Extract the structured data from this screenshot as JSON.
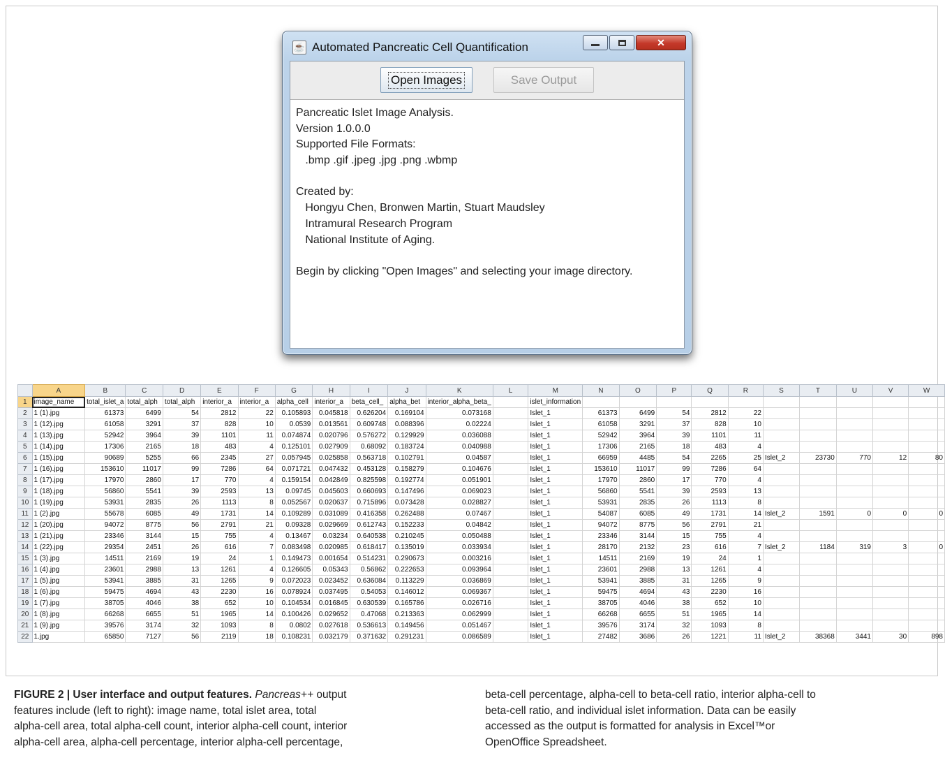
{
  "dialog": {
    "title": "Automated Pancreatic Cell Quantification",
    "buttons": {
      "open": "Open Images",
      "save": "Save Output"
    },
    "text_lines": [
      "Pancreatic Islet Image Analysis.",
      "Version 1.0.0.0",
      "Supported File Formats:",
      "   .bmp .gif .jpeg .jpg .png .wbmp",
      "",
      "Created by:",
      "   Hongyu Chen, Bronwen Martin, Stuart Maudsley",
      "   Intramural Research Program",
      "   National Institute of Aging.",
      "",
      "Begin by clicking \"Open Images\" and selecting your image directory."
    ]
  },
  "spreadsheet": {
    "column_letters": [
      "A",
      "B",
      "C",
      "D",
      "E",
      "F",
      "G",
      "H",
      "I",
      "J",
      "K",
      "L",
      "M",
      "N",
      "O",
      "P",
      "Q",
      "R",
      "S",
      "T",
      "U",
      "V",
      "W"
    ],
    "header_row": [
      "image_name",
      "total_islet_a",
      "total_alph",
      "total_alph",
      "interior_a",
      "interior_a",
      "alpha_cell",
      "interior_a",
      "beta_cell_",
      "alpha_bet",
      "interior_alpha_beta_",
      "",
      "islet_information",
      "",
      "",
      "",
      "",
      "",
      "",
      "",
      "",
      "",
      ""
    ],
    "rows": [
      [
        "1 (1).jpg",
        "61373",
        "6499",
        "54",
        "2812",
        "22",
        "0.105893",
        "0.045818",
        "0.626204",
        "0.169104",
        "0.073168",
        "",
        "Islet_1",
        "61373",
        "6499",
        "54",
        "2812",
        "22",
        "",
        "",
        "",
        "",
        ""
      ],
      [
        "1 (12).jpg",
        "61058",
        "3291",
        "37",
        "828",
        "10",
        "0.0539",
        "0.013561",
        "0.609748",
        "0.088396",
        "0.02224",
        "",
        "Islet_1",
        "61058",
        "3291",
        "37",
        "828",
        "10",
        "",
        "",
        "",
        "",
        ""
      ],
      [
        "1 (13).jpg",
        "52942",
        "3964",
        "39",
        "1101",
        "11",
        "0.074874",
        "0.020796",
        "0.576272",
        "0.129929",
        "0.036088",
        "",
        "Islet_1",
        "52942",
        "3964",
        "39",
        "1101",
        "11",
        "",
        "",
        "",
        "",
        ""
      ],
      [
        "1 (14).jpg",
        "17306",
        "2165",
        "18",
        "483",
        "4",
        "0.125101",
        "0.027909",
        "0.68092",
        "0.183724",
        "0.040988",
        "",
        "Islet_1",
        "17306",
        "2165",
        "18",
        "483",
        "4",
        "",
        "",
        "",
        "",
        ""
      ],
      [
        "1 (15).jpg",
        "90689",
        "5255",
        "66",
        "2345",
        "27",
        "0.057945",
        "0.025858",
        "0.563718",
        "0.102791",
        "0.04587",
        "",
        "Islet_1",
        "66959",
        "4485",
        "54",
        "2265",
        "25",
        "Islet_2",
        "23730",
        "770",
        "12",
        "80"
      ],
      [
        "1 (16).jpg",
        "153610",
        "11017",
        "99",
        "7286",
        "64",
        "0.071721",
        "0.047432",
        "0.453128",
        "0.158279",
        "0.104676",
        "",
        "Islet_1",
        "153610",
        "11017",
        "99",
        "7286",
        "64",
        "",
        "",
        "",
        "",
        ""
      ],
      [
        "1 (17).jpg",
        "17970",
        "2860",
        "17",
        "770",
        "4",
        "0.159154",
        "0.042849",
        "0.825598",
        "0.192774",
        "0.051901",
        "",
        "Islet_1",
        "17970",
        "2860",
        "17",
        "770",
        "4",
        "",
        "",
        "",
        "",
        ""
      ],
      [
        "1 (18).jpg",
        "56860",
        "5541",
        "39",
        "2593",
        "13",
        "0.09745",
        "0.045603",
        "0.660693",
        "0.147496",
        "0.069023",
        "",
        "Islet_1",
        "56860",
        "5541",
        "39",
        "2593",
        "13",
        "",
        "",
        "",
        "",
        ""
      ],
      [
        "1 (19).jpg",
        "53931",
        "2835",
        "26",
        "1113",
        "8",
        "0.052567",
        "0.020637",
        "0.715896",
        "0.073428",
        "0.028827",
        "",
        "Islet_1",
        "53931",
        "2835",
        "26",
        "1113",
        "8",
        "",
        "",
        "",
        "",
        ""
      ],
      [
        "1 (2).jpg",
        "55678",
        "6085",
        "49",
        "1731",
        "14",
        "0.109289",
        "0.031089",
        "0.416358",
        "0.262488",
        "0.07467",
        "",
        "Islet_1",
        "54087",
        "6085",
        "49",
        "1731",
        "14",
        "Islet_2",
        "1591",
        "0",
        "0",
        "0"
      ],
      [
        "1 (20).jpg",
        "94072",
        "8775",
        "56",
        "2791",
        "21",
        "0.09328",
        "0.029669",
        "0.612743",
        "0.152233",
        "0.04842",
        "",
        "Islet_1",
        "94072",
        "8775",
        "56",
        "2791",
        "21",
        "",
        "",
        "",
        "",
        ""
      ],
      [
        "1 (21).jpg",
        "23346",
        "3144",
        "15",
        "755",
        "4",
        "0.13467",
        "0.03234",
        "0.640538",
        "0.210245",
        "0.050488",
        "",
        "Islet_1",
        "23346",
        "3144",
        "15",
        "755",
        "4",
        "",
        "",
        "",
        "",
        ""
      ],
      [
        "1 (22).jpg",
        "29354",
        "2451",
        "26",
        "616",
        "7",
        "0.083498",
        "0.020985",
        "0.618417",
        "0.135019",
        "0.033934",
        "",
        "Islet_1",
        "28170",
        "2132",
        "23",
        "616",
        "7",
        "Islet_2",
        "1184",
        "319",
        "3",
        "0"
      ],
      [
        "1 (3).jpg",
        "14511",
        "2169",
        "19",
        "24",
        "1",
        "0.149473",
        "0.001654",
        "0.514231",
        "0.290673",
        "0.003216",
        "",
        "Islet_1",
        "14511",
        "2169",
        "19",
        "24",
        "1",
        "",
        "",
        "",
        "",
        ""
      ],
      [
        "1 (4).jpg",
        "23601",
        "2988",
        "13",
        "1261",
        "4",
        "0.126605",
        "0.05343",
        "0.56862",
        "0.222653",
        "0.093964",
        "",
        "Islet_1",
        "23601",
        "2988",
        "13",
        "1261",
        "4",
        "",
        "",
        "",
        "",
        ""
      ],
      [
        "1 (5).jpg",
        "53941",
        "3885",
        "31",
        "1265",
        "9",
        "0.072023",
        "0.023452",
        "0.636084",
        "0.113229",
        "0.036869",
        "",
        "Islet_1",
        "53941",
        "3885",
        "31",
        "1265",
        "9",
        "",
        "",
        "",
        "",
        ""
      ],
      [
        "1 (6).jpg",
        "59475",
        "4694",
        "43",
        "2230",
        "16",
        "0.078924",
        "0.037495",
        "0.54053",
        "0.146012",
        "0.069367",
        "",
        "Islet_1",
        "59475",
        "4694",
        "43",
        "2230",
        "16",
        "",
        "",
        "",
        "",
        ""
      ],
      [
        "1 (7).jpg",
        "38705",
        "4046",
        "38",
        "652",
        "10",
        "0.104534",
        "0.016845",
        "0.630539",
        "0.165786",
        "0.026716",
        "",
        "Islet_1",
        "38705",
        "4046",
        "38",
        "652",
        "10",
        "",
        "",
        "",
        "",
        ""
      ],
      [
        "1 (8).jpg",
        "66268",
        "6655",
        "51",
        "1965",
        "14",
        "0.100426",
        "0.029652",
        "0.47068",
        "0.213363",
        "0.062999",
        "",
        "Islet_1",
        "66268",
        "6655",
        "51",
        "1965",
        "14",
        "",
        "",
        "",
        "",
        ""
      ],
      [
        "1 (9).jpg",
        "39576",
        "3174",
        "32",
        "1093",
        "8",
        "0.0802",
        "0.027618",
        "0.536613",
        "0.149456",
        "0.051467",
        "",
        "Islet_1",
        "39576",
        "3174",
        "32",
        "1093",
        "8",
        "",
        "",
        "",
        "",
        ""
      ],
      [
        "1.jpg",
        "65850",
        "7127",
        "56",
        "2119",
        "18",
        "0.108231",
        "0.032179",
        "0.371632",
        "0.291231",
        "0.086589",
        "",
        "Islet_1",
        "27482",
        "3686",
        "26",
        "1221",
        "11",
        "Islet_2",
        "38368",
        "3441",
        "30",
        "898"
      ]
    ]
  },
  "caption": {
    "label": "FIGURE 2 | User interface and output features.",
    "app_name": "Pancreas++",
    "left_tail_first": " output",
    "left_lines": [
      "features include (left to right): image name, total islet area, total",
      "alpha-cell area, total alpha-cell count, interior alpha-cell count, interior",
      "alpha-cell area, alpha-cell percentage, interior alpha-cell percentage,"
    ],
    "right_lines": [
      "beta-cell percentage, alpha-cell to beta-cell ratio, interior alpha-cell to",
      "beta-cell ratio, and individual islet information. Data can be easily",
      "accessed as the output is formatted for analysis in Excel™or",
      "OpenOffice Spreadsheet."
    ]
  }
}
